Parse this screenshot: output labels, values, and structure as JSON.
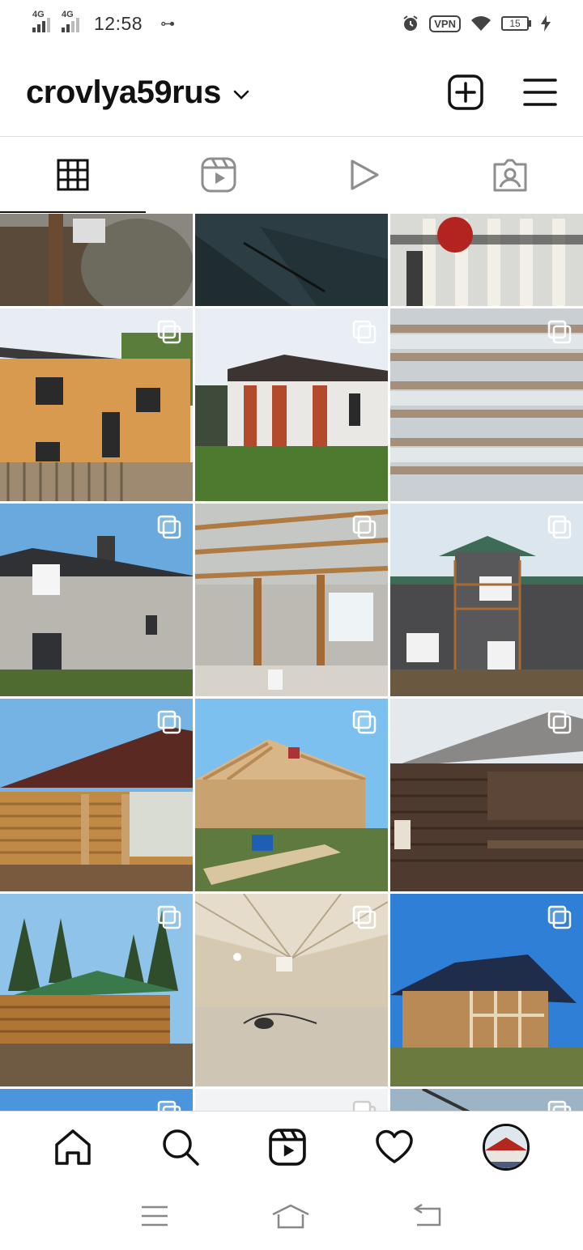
{
  "status_bar": {
    "network_1": "4G",
    "network_2": "4G",
    "time": "12:58",
    "vpn": "VPN",
    "battery": "15"
  },
  "header": {
    "username": "crovlya59rus"
  },
  "tabs": [
    {
      "name": "grid",
      "active": true
    },
    {
      "name": "reels",
      "active": false
    },
    {
      "name": "videos",
      "active": false
    },
    {
      "name": "tagged",
      "active": false
    }
  ],
  "posts": [
    {
      "subject": "roof work close-up",
      "multi": false
    },
    {
      "subject": "dark metal roofing sheet",
      "multi": false
    },
    {
      "subject": "roof battens with tools",
      "multi": false
    },
    {
      "subject": "brick two-storey house",
      "multi": true
    },
    {
      "subject": "white house with brick pillars",
      "multi": true
    },
    {
      "subject": "roof underlayment and battens",
      "multi": true
    },
    {
      "subject": "block house with dormers",
      "multi": true
    },
    {
      "subject": "interior rafters and beams",
      "multi": true
    },
    {
      "subject": "grey house with scaffolding",
      "multi": true
    },
    {
      "subject": "log house with brown roof",
      "multi": true
    },
    {
      "subject": "roof frame with worker",
      "multi": true
    },
    {
      "subject": "dark log house with balcony",
      "multi": true
    },
    {
      "subject": "log cabin in forest",
      "multi": true
    },
    {
      "subject": "wooden attic interior",
      "multi": true
    },
    {
      "subject": "timber frame house blue roof",
      "multi": true
    }
  ],
  "bottom_nav": [
    "home",
    "search",
    "reels",
    "activity",
    "profile"
  ],
  "colors": {
    "active_indicator": "#111111",
    "inactive_icon": "#8e8e8e",
    "divider": "#dbdbdb"
  }
}
